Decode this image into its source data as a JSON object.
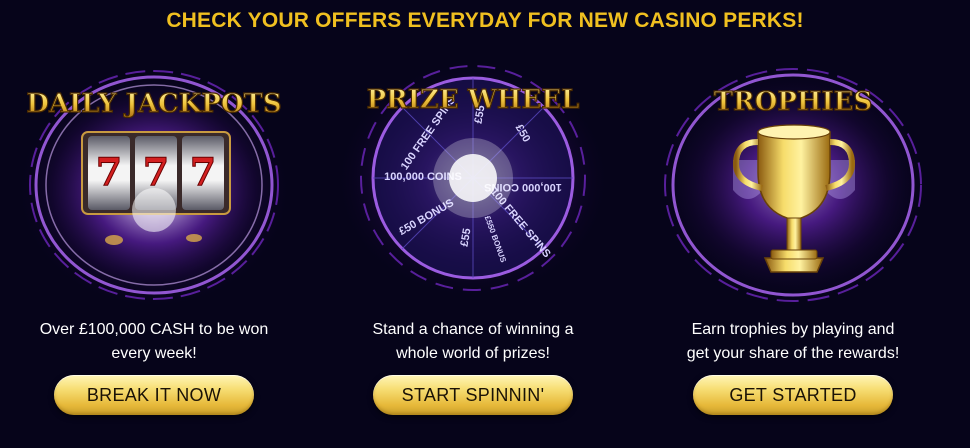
{
  "headline": "CHECK YOUR OFFERS EVERYDAY FOR NEW CASINO PERKS!",
  "cards": [
    {
      "title": "DAILY JACKPOTS",
      "desc_line1": "Over £100,000 CASH to be won",
      "desc_line2": "every week!",
      "button": "BREAK IT NOW",
      "reel_symbols": [
        "7",
        "7",
        "7"
      ]
    },
    {
      "title": "PRIZE WHEEL",
      "desc_line1": "Stand a chance of winning a",
      "desc_line2": "whole world of prizes!",
      "button": "START SPINNIN'",
      "wheel_labels": [
        "100 FREE SPINS",
        "£55",
        "£50",
        "100,000 COINS",
        "100,000 COINS",
        "£50 BONUS",
        "£55",
        "100 FREE SPINS",
        "£550 BONUS"
      ]
    },
    {
      "title": "TROPHIES",
      "desc_line1": "Earn trophies by playing and",
      "desc_line2": "get your share of the rewards!",
      "button": "GET STARTED"
    }
  ],
  "colors": {
    "background": "#06041a",
    "headline": "#f0c020",
    "button_gold": "#e7b93a",
    "glow_purple": "#9b4dff"
  }
}
